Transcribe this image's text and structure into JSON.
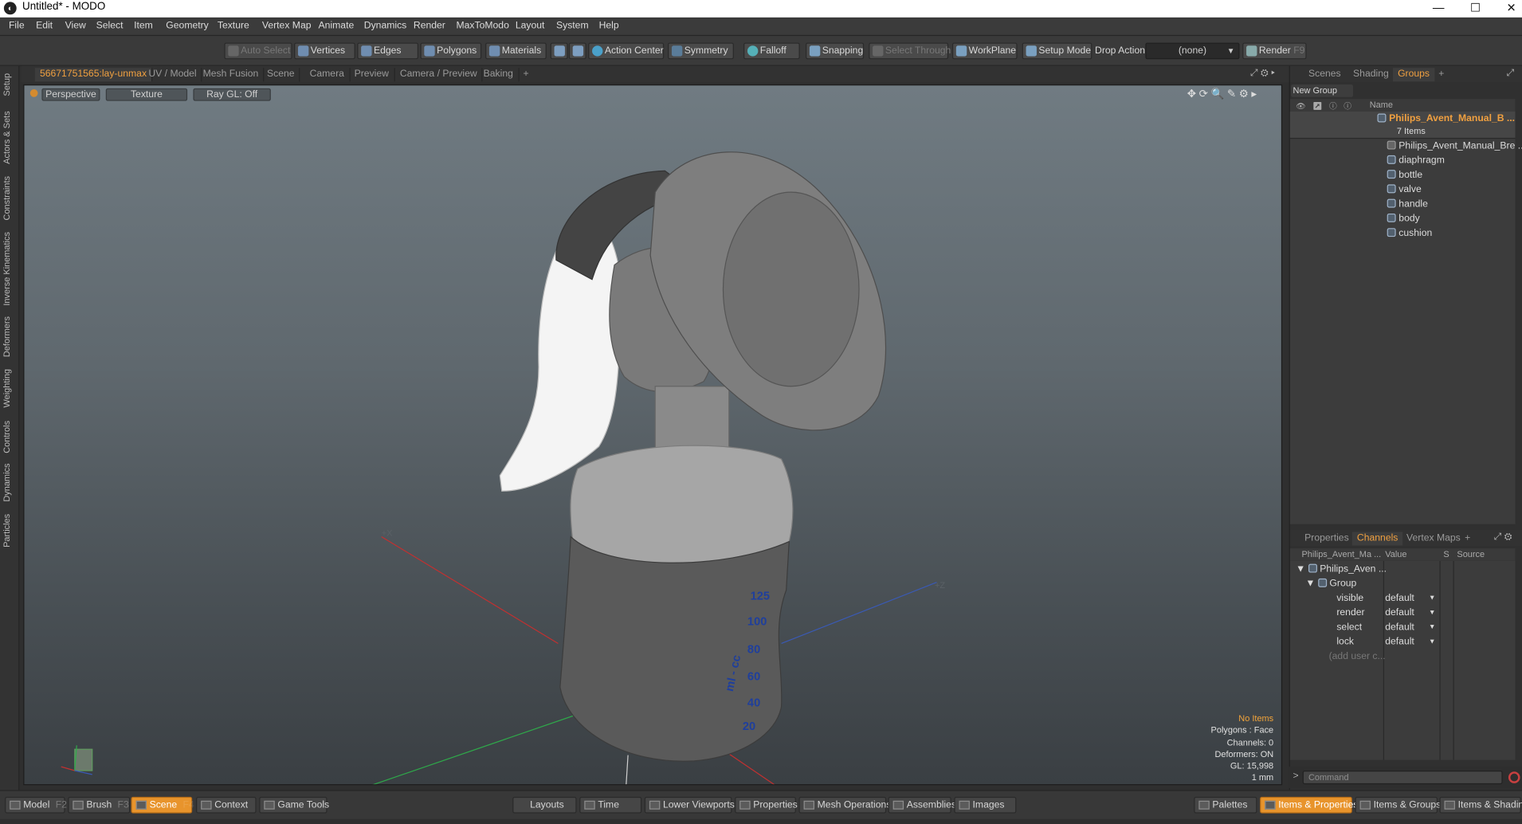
{
  "window": {
    "title": "Untitled* - MODO",
    "app_icon": "modo-logo",
    "min": "—",
    "max": "☐",
    "close": "✕"
  },
  "menu": [
    "File",
    "Edit",
    "View",
    "Select",
    "Item",
    "Geometry",
    "Texture",
    "Vertex Map",
    "Animate",
    "Dynamics",
    "Render",
    "MaxToModo",
    "Layout",
    "System",
    "Help"
  ],
  "toolbar": {
    "auto_select": "Auto Select",
    "vertices": "Vertices",
    "edges": "Edges",
    "polygons": "Polygons",
    "materials": "Materials",
    "action_center": "Action Center",
    "symmetry": "Symmetry",
    "falloff": "Falloff",
    "snapping": "Snapping",
    "select_through": "Select Through",
    "workplane": "WorkPlane",
    "setup_mode": "Setup Mode",
    "drop_action": "Drop Action",
    "drop_value": "(none)",
    "render": "Render",
    "render_key": "F9"
  },
  "left_tabs": [
    "Setup",
    "Actors & Sets",
    "Constraints",
    "Inverse Kinematics",
    "Deformers",
    "Weighting",
    "Controls",
    "Dynamics",
    "Particles"
  ],
  "viewport_tabs": [
    "56671751565:lay-unmax",
    "UV / Model",
    "Mesh Fusion",
    "Scene",
    "Camera",
    "Preview",
    "Camera / Preview",
    "Baking",
    "+"
  ],
  "viewport": {
    "view": "Perspective",
    "shading": "Texture",
    "raygl": "Ray GL: Off",
    "axis_x": "+X",
    "axis_z": "+Z",
    "bottle_marks": [
      "125",
      "100",
      "80",
      "60",
      "40",
      "20"
    ],
    "bottle_unit": "ml - cc",
    "info": {
      "items": "No Items",
      "polygons": "Polygons : Face",
      "channels": "Channels: 0",
      "deformers": "Deformers: ON",
      "gl": "GL: 15,998",
      "unit": "1 mm"
    }
  },
  "right_top_tabs": [
    "Scenes",
    "Shading",
    "Groups",
    "+"
  ],
  "groups": {
    "new_group": "New Group",
    "name_header": "Name",
    "root": "Philips_Avent_Manual_B ...",
    "count": "7 Items",
    "items": [
      "Philips_Avent_Manual_Bre ...",
      "diaphragm",
      "bottle",
      "valve",
      "handle",
      "body",
      "cushion"
    ]
  },
  "right_bottom_tabs": [
    "Properties",
    "Channels",
    "Vertex Maps",
    "+"
  ],
  "channels": {
    "headers": [
      "Philips_Avent_Ma ...",
      "Value",
      "S",
      "Source"
    ],
    "root": "Philips_Aven ...",
    "group": "Group",
    "rows": [
      {
        "name": "visible",
        "value": "default"
      },
      {
        "name": "render",
        "value": "default"
      },
      {
        "name": "select",
        "value": "default"
      },
      {
        "name": "lock",
        "value": "default"
      }
    ],
    "add_user": "(add user c..."
  },
  "command_placeholder": "Command",
  "command_prompt": ">",
  "bottom": {
    "model": "Model",
    "model_key": "F2",
    "brush": "Brush",
    "brush_key": "F3",
    "scene": "Scene",
    "scene_key": "F4",
    "context": "Context",
    "game_tools": "Game Tools",
    "layouts": "Layouts",
    "time": "Time",
    "lower_viewports": "Lower Viewports",
    "properties": "Properties",
    "mesh_operations": "Mesh Operations",
    "assemblies": "Assemblies",
    "images": "Images",
    "palettes": "Palettes",
    "items_properties": "Items & Properties",
    "items_groups": "Items & Groups",
    "items_shading": "Items & Shading"
  },
  "colors": {
    "accent": "#f0a040",
    "active_button": "#e8942c",
    "bottle_marks": "#1f3f9c"
  }
}
